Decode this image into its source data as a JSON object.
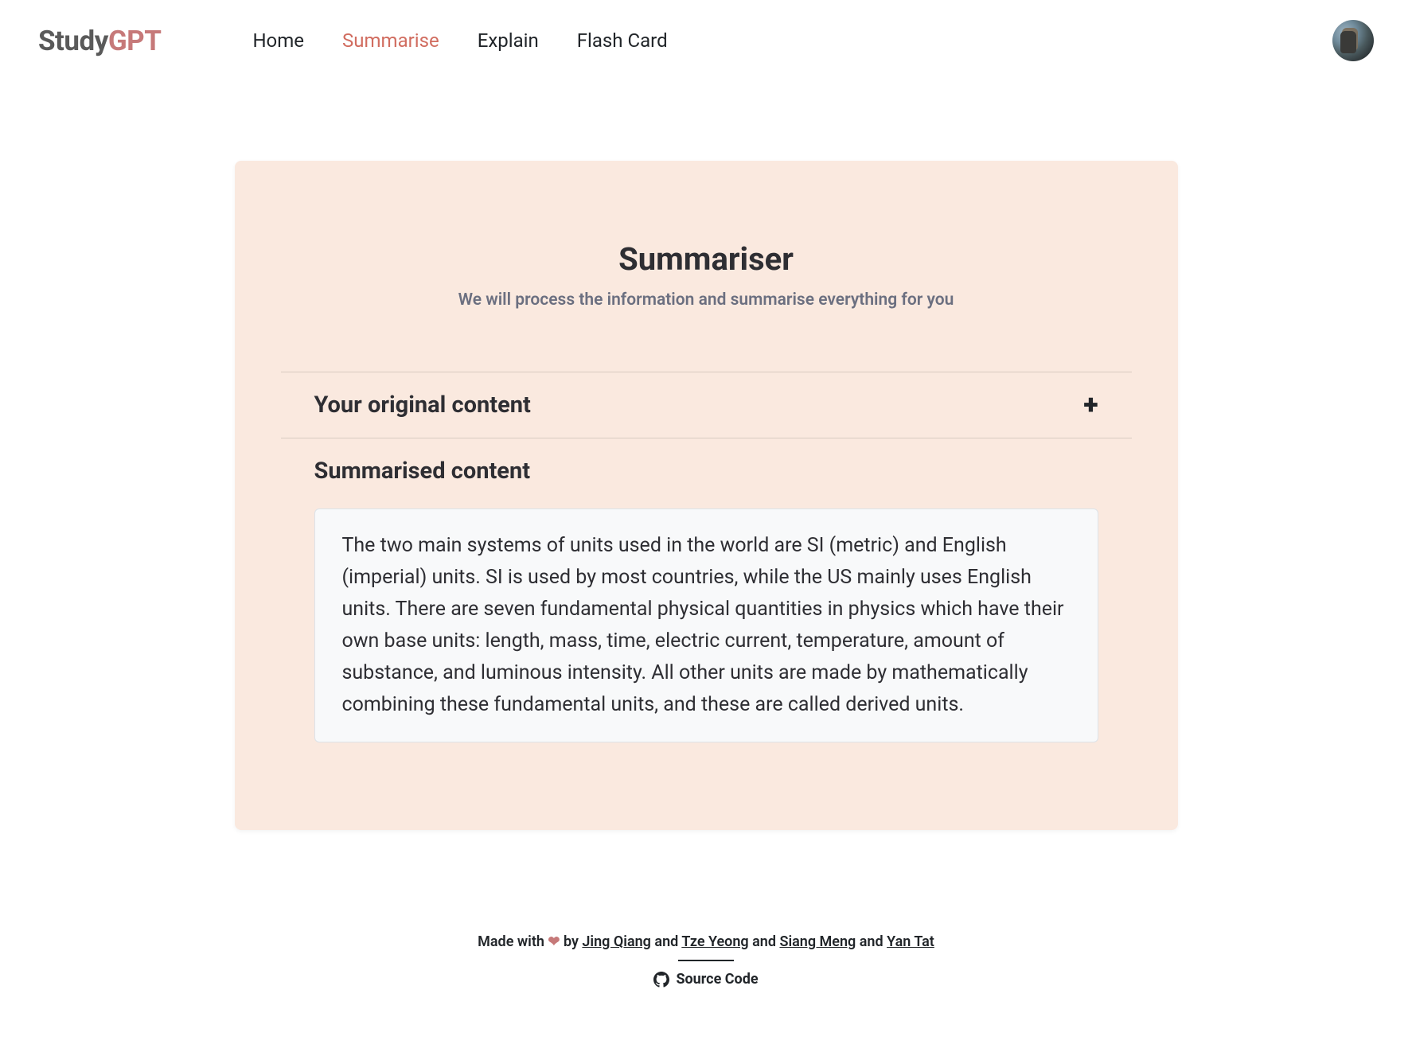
{
  "brand": {
    "part1": "Study",
    "part2": "GPT"
  },
  "nav": {
    "home": "Home",
    "summarise": "Summarise",
    "explain": "Explain",
    "flashcard": "Flash Card"
  },
  "page": {
    "title": "Summariser",
    "subtitle": "We will process the information and summarise everything for you"
  },
  "sections": {
    "original_label": "Your original content",
    "summarised_label": "Summarised content",
    "summary_text": "The two main systems of units used in the world are SI (metric) and English (imperial) units. SI is used by most countries, while the US mainly uses English units. There are seven fundamental physical quantities in physics which have their own base units: length, mass, time, electric current, temperature, amount of substance, and luminous intensity. All other units are made by mathematically combining these fundamental units, and these are called derived units."
  },
  "footer": {
    "made_with": "Made with ",
    "heart": "❤",
    "by": " by ",
    "authors": {
      "a1": "Jing Qiang",
      "a2": "Tze Yeong",
      "a3": "Siang Meng",
      "a4": "Yan Tat"
    },
    "and": " and ",
    "source_code": "Source Code"
  }
}
